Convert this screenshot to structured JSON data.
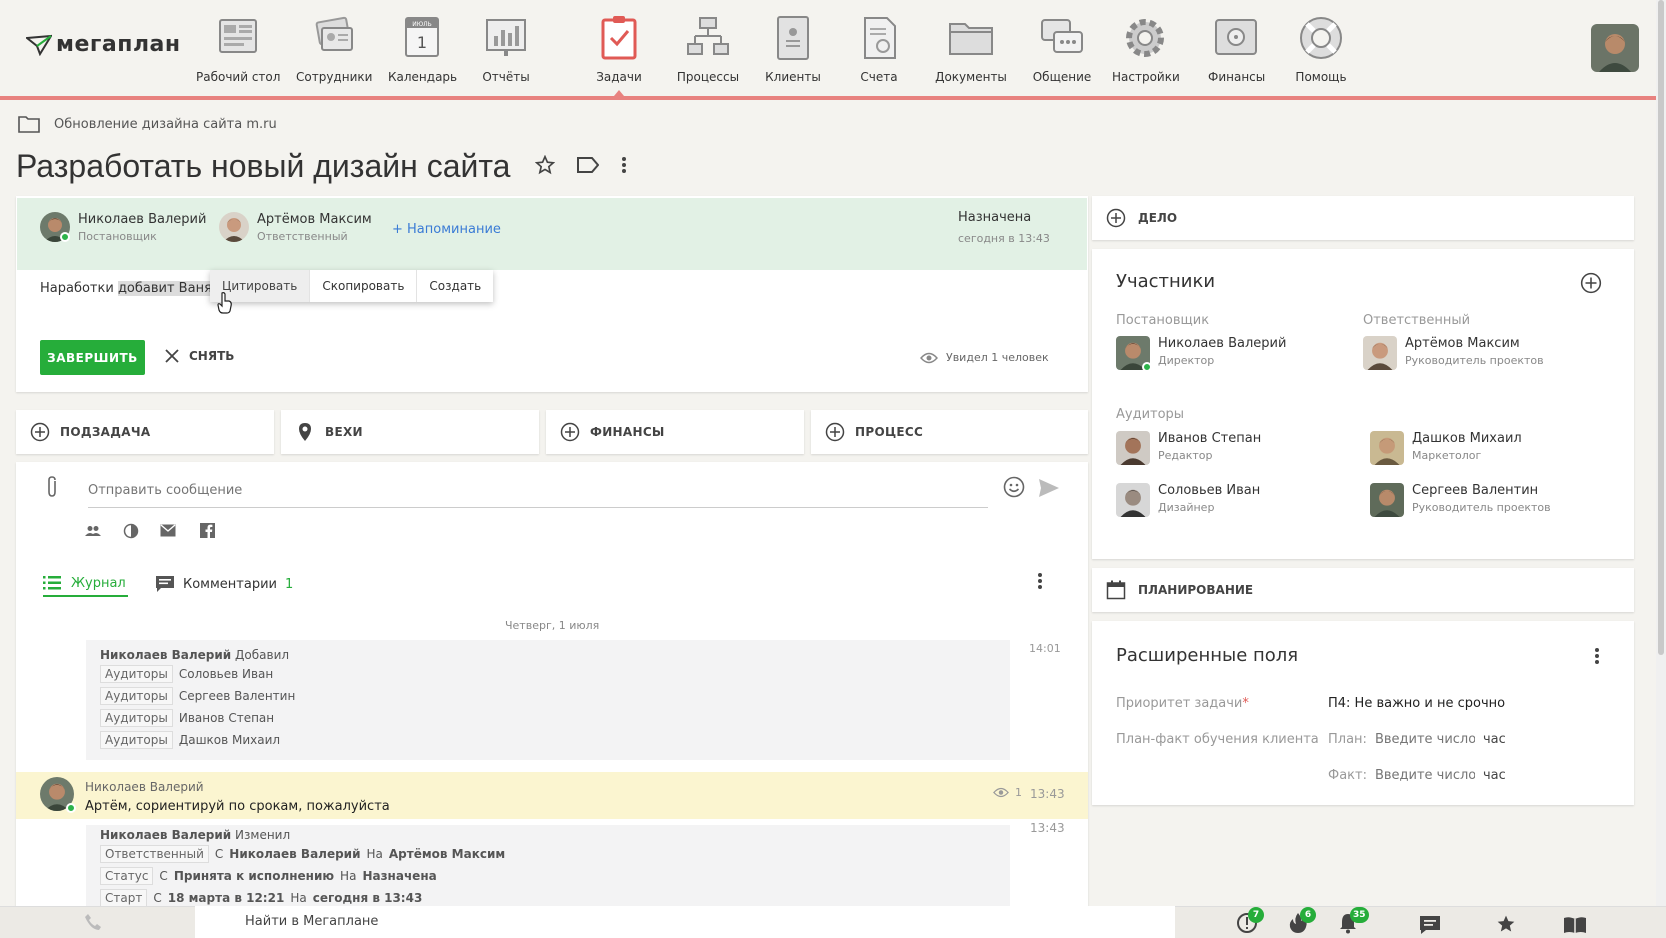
{
  "app": {
    "logo_text": "мегаплан"
  },
  "nav": [
    {
      "label": "Рабочий стол",
      "icon": "desktop-icon"
    },
    {
      "label": "Сотрудники",
      "icon": "employees-icon"
    },
    {
      "label": "Календарь",
      "icon": "calendar-icon",
      "calendar_month": "ИЮЛЬ",
      "calendar_day": "1"
    },
    {
      "label": "Отчёты",
      "icon": "reports-icon"
    },
    {
      "label": "Задачи",
      "icon": "tasks-icon",
      "active": true
    },
    {
      "label": "Процессы",
      "icon": "processes-icon"
    },
    {
      "label": "Клиенты",
      "icon": "clients-icon"
    },
    {
      "label": "Счета",
      "icon": "invoices-icon"
    },
    {
      "label": "Документы",
      "icon": "documents-icon"
    },
    {
      "label": "Общение",
      "icon": "chat-icon"
    },
    {
      "label": "Настройки",
      "icon": "settings-icon"
    },
    {
      "label": "Финансы",
      "icon": "finance-icon"
    },
    {
      "label": "Помощь",
      "icon": "help-icon"
    }
  ],
  "breadcrumb": {
    "project": "Обновление дизайна сайта m.ru"
  },
  "task": {
    "title": "Разработать новый дизайн сайта",
    "setter": {
      "name": "Николаев Валерий",
      "role": "Постановщик"
    },
    "responsible": {
      "name": "Артёмов Максим",
      "role": "Ответственный"
    },
    "reminder_link": "+ Напоминание",
    "status": "Назначена",
    "status_time": "сегодня в 13:43",
    "description_pre": "Наработки ",
    "description_selected": "добавит Ваня",
    "context_menu": [
      "Цитировать",
      "Скопировать",
      "Создать"
    ],
    "complete_button": "ЗАВЕРШИТЬ",
    "remove_button": "СНЯТЬ",
    "seen_text": "Увидел 1 человек"
  },
  "tiles": [
    {
      "label": "ПОДЗАДАЧА",
      "icon": "plus-circle-icon"
    },
    {
      "label": "ВЕХИ",
      "icon": "location-pin-icon"
    },
    {
      "label": "ФИНАНСЫ",
      "icon": "plus-circle-icon"
    },
    {
      "label": "ПРОЦЕСС",
      "icon": "plus-circle-icon"
    }
  ],
  "composer": {
    "placeholder": "Отправить сообщение",
    "tabs": [
      {
        "label": "Журнал"
      },
      {
        "label": "Комментарии",
        "count": "1"
      }
    ]
  },
  "journal": {
    "date": "Четверг, 1 июля",
    "entry1": {
      "author": "Николаев Валерий",
      "action": "Добавил",
      "time": "14:01",
      "lines": [
        {
          "tag": "Аудиторы",
          "value": "Соловьев Иван"
        },
        {
          "tag": "Аудиторы",
          "value": "Сергеев Валентин"
        },
        {
          "tag": "Аудиторы",
          "value": "Иванов Степан"
        },
        {
          "tag": "Аудиторы",
          "value": "Дашков Михаил"
        }
      ]
    },
    "comment": {
      "author": "Николаев Валерий",
      "text": "Артём, сориентируй по срокам, пожалуйста",
      "views": "1",
      "time": "13:43"
    },
    "entry2": {
      "author": "Николаев Валерий",
      "action": "Изменил",
      "time": "13:43",
      "lines": [
        {
          "tag": "Ответственный",
          "from_word": "С",
          "from": "Николаев Валерий",
          "to_word": "На",
          "to": "Артёмов Максим"
        },
        {
          "tag": "Статус",
          "from_word": "С",
          "from": "Принята к исполнению",
          "to_word": "На",
          "to": "Назначена"
        },
        {
          "tag": "Старт",
          "from_word": "С",
          "from": "18 марта в 12:21",
          "to_word": "На",
          "to": "сегодня в 13:43"
        }
      ]
    }
  },
  "right": {
    "delo": "ДЕЛО",
    "participants": {
      "title": "Участники",
      "setter_label": "Постановщик",
      "responsible_label": "Ответственный",
      "setter": {
        "name": "Николаев Валерий",
        "role": "Директор"
      },
      "responsible": {
        "name": "Артёмов Максим",
        "role": "Руководитель проектов"
      },
      "auditors_label": "Аудиторы",
      "auditors": [
        {
          "name": "Иванов Степан",
          "role": "Редактор"
        },
        {
          "name": "Дашков Михаил",
          "role": "Маркетолог"
        },
        {
          "name": "Соловьев Иван",
          "role": "Дизайнер"
        },
        {
          "name": "Сергеев Валентин",
          "role": "Руководитель проектов"
        }
      ]
    },
    "planning": "ПЛАНИРОВАНИЕ",
    "ext": {
      "title": "Расширенные поля",
      "priority_label": "Приоритет задачи",
      "priority_required": "*",
      "priority_value": "П4: Не важно и не срочно",
      "planfact_label": "План-факт обучения клиента",
      "plan_label": "План:",
      "fact_label": "Факт:",
      "placeholder": "Введите число",
      "unit": "час"
    }
  },
  "footer": {
    "search": "Найти в Мегаплане",
    "badges": {
      "alerts": "7",
      "hot": "6",
      "notifications": "35"
    }
  },
  "colors": {
    "accent_green": "#26ad3a",
    "header_line": "#e8827f",
    "link_blue": "#3a7bd5"
  }
}
